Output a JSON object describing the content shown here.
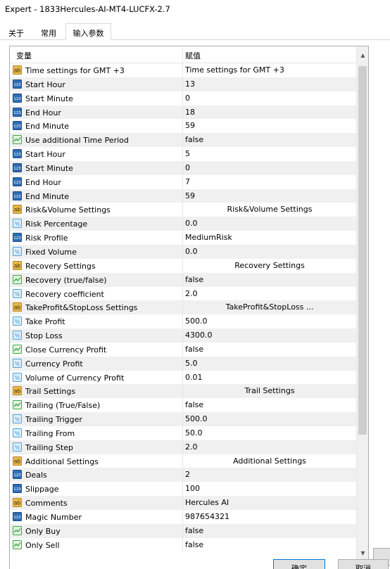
{
  "window": {
    "title": "Expert - 1833Hercules-AI-MT4-LUCFX-2.7"
  },
  "tabs": [
    {
      "label": "关于"
    },
    {
      "label": "常用"
    },
    {
      "label": "输入参数"
    }
  ],
  "grid": {
    "header": {
      "name": "变量",
      "value": "赋值"
    },
    "rows": [
      {
        "type": "ab",
        "name": "Time settings for GMT +3",
        "value": "Time settings for GMT +3",
        "align": "left"
      },
      {
        "type": "123",
        "name": "Start Hour",
        "value": "13"
      },
      {
        "type": "123",
        "name": "Start Minute",
        "value": "0"
      },
      {
        "type": "123",
        "name": "End Hour",
        "value": "18"
      },
      {
        "type": "123",
        "name": "End Minute",
        "value": "59"
      },
      {
        "type": "bool",
        "name": "Use additional Time Period",
        "value": "false"
      },
      {
        "type": "123",
        "name": "Start Hour",
        "value": "5"
      },
      {
        "type": "123",
        "name": "Start Minute",
        "value": "0"
      },
      {
        "type": "123",
        "name": "End Hour",
        "value": "7"
      },
      {
        "type": "123",
        "name": "End Minute",
        "value": "59"
      },
      {
        "type": "ab",
        "name": "Risk&Volume Settings",
        "value": "Risk&Volume Settings",
        "align": "center"
      },
      {
        "type": "dbl",
        "name": "Risk Percentage",
        "value": "0.0"
      },
      {
        "type": "123",
        "name": "Risk Profile",
        "value": "MediumRisk"
      },
      {
        "type": "dbl",
        "name": "Fixed Volume",
        "value": "0.0"
      },
      {
        "type": "ab",
        "name": "Recovery Settings",
        "value": "Recovery Settings",
        "align": "center"
      },
      {
        "type": "bool",
        "name": "Recovery (true/false)",
        "value": "false"
      },
      {
        "type": "dbl",
        "name": "Recovery coefficient",
        "value": "2.0"
      },
      {
        "type": "ab",
        "name": "TakeProfit&StopLoss Settings",
        "value": "TakeProfit&StopLoss ...",
        "align": "center"
      },
      {
        "type": "dbl",
        "name": "Take Profit",
        "value": "500.0"
      },
      {
        "type": "dbl",
        "name": "Stop Loss",
        "value": "4300.0"
      },
      {
        "type": "bool",
        "name": "Close Currency Profit",
        "value": "false"
      },
      {
        "type": "dbl",
        "name": "Currency Profit",
        "value": "5.0"
      },
      {
        "type": "dbl",
        "name": "Volume of Currency Profit",
        "value": "0.01"
      },
      {
        "type": "ab",
        "name": "Trail Settings",
        "value": "Trail Settings",
        "align": "center"
      },
      {
        "type": "bool",
        "name": "Trailing (True/False)",
        "value": "false"
      },
      {
        "type": "dbl",
        "name": "Trailing Trigger",
        "value": "500.0"
      },
      {
        "type": "dbl",
        "name": "Trailing From",
        "value": "50.0"
      },
      {
        "type": "dbl",
        "name": "Trailing Step",
        "value": "2.0"
      },
      {
        "type": "ab",
        "name": "Additional Settings",
        "value": "Additional Settings",
        "align": "center"
      },
      {
        "type": "123",
        "name": "Deals",
        "value": "2"
      },
      {
        "type": "123",
        "name": "Slippage",
        "value": "100"
      },
      {
        "type": "ab",
        "name": "Comments",
        "value": "Hercules AI"
      },
      {
        "type": "123",
        "name": "Magic Number",
        "value": "987654321"
      },
      {
        "type": "bool",
        "name": "Only Buy",
        "value": "false"
      },
      {
        "type": "bool",
        "name": "Only Sell",
        "value": "false"
      }
    ]
  },
  "buttons": {
    "ok": "确定",
    "cancel": "取消"
  },
  "colors": {
    "ab_icon": "#e8b84a",
    "int_icon": "#2f6db5",
    "dbl_icon": "#4aa3df",
    "bool_icon": "#3aa845"
  }
}
